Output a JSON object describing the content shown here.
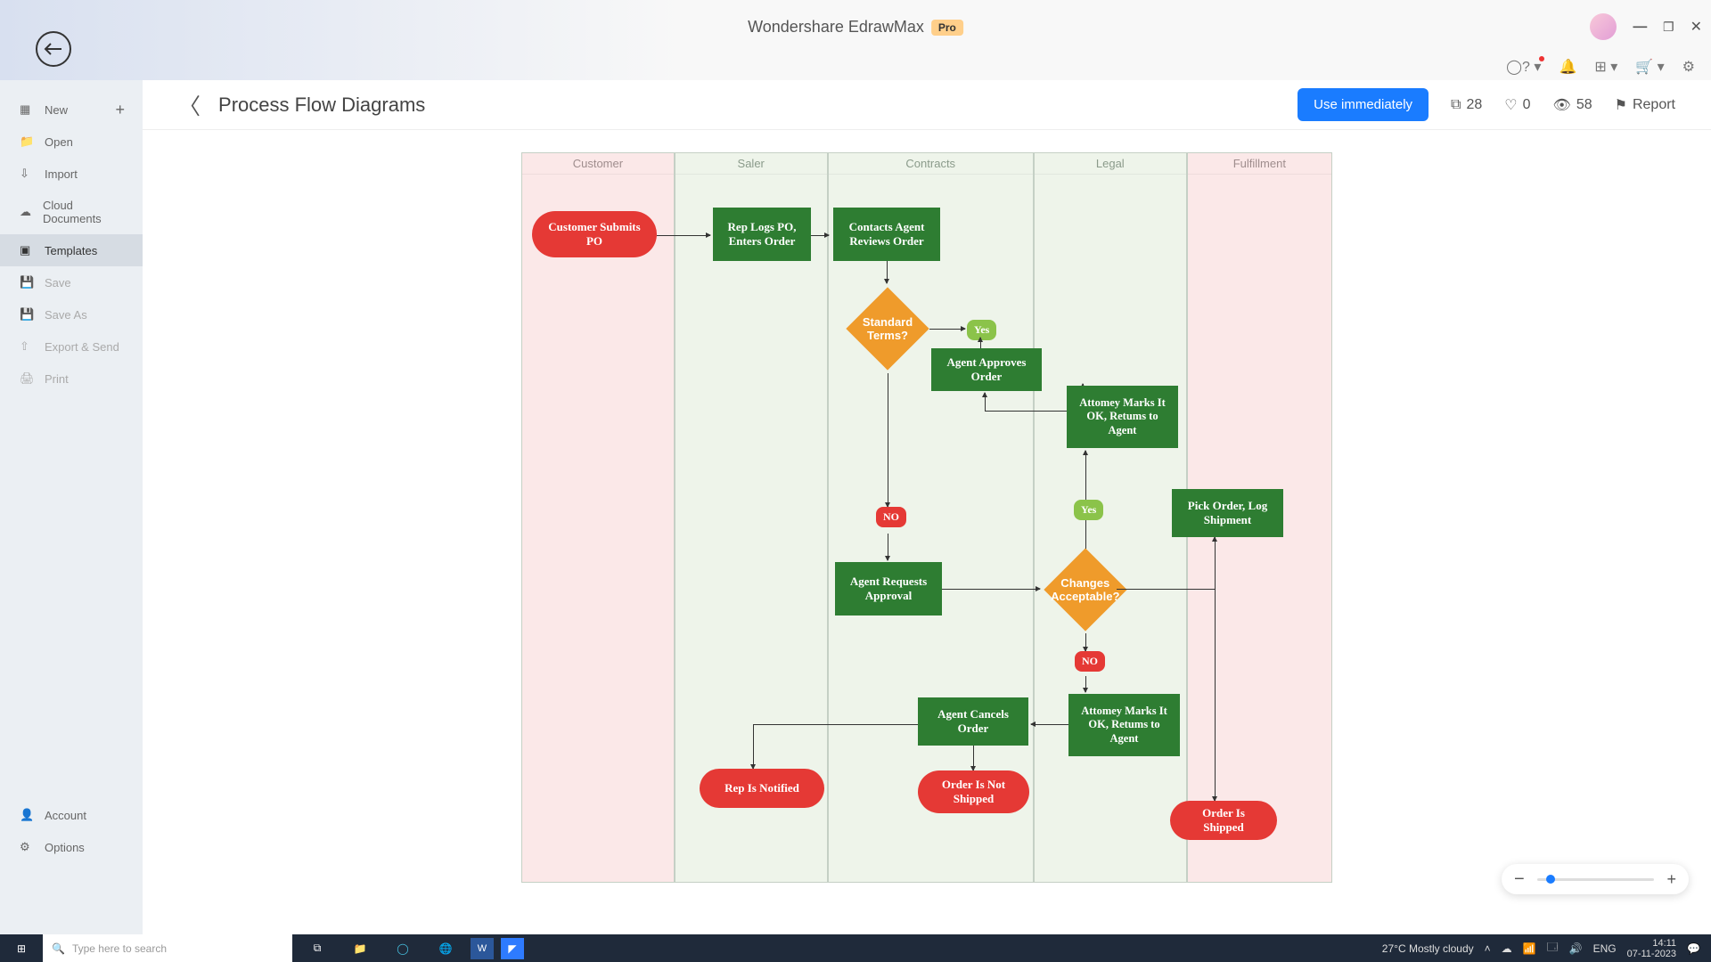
{
  "app": {
    "title": "Wondershare EdrawMax",
    "badge": "Pro"
  },
  "sidebar": {
    "new": "New",
    "open": "Open",
    "import": "Import",
    "cloud": "Cloud Documents",
    "templates": "Templates",
    "save": "Save",
    "saveas": "Save As",
    "export": "Export & Send",
    "print": "Print",
    "account": "Account",
    "options": "Options"
  },
  "header": {
    "title": "Process Flow Diagrams",
    "primary": "Use immediately",
    "copies": "28",
    "likes": "0",
    "views": "58",
    "report": "Report"
  },
  "lanes": {
    "customer": "Customer",
    "saler": "Saler",
    "contracts": "Contracts",
    "legal": "Legal",
    "fulfillment": "Fulfillment"
  },
  "nodes": {
    "submitpo": "Customer Submits PO",
    "replogs": "Rep Logs PO, Enters Order",
    "contactsagent": "Contacts Agent Reviews Order",
    "stdterms": "Standard Terms?",
    "yes1": "Yes",
    "agentapproves": "Agent Approves Order",
    "attorney1": "Attomey Marks It OK, Retums to Agent",
    "yes2": "Yes",
    "no1": "NO",
    "agentrequests": "Agent Requests Approval",
    "pickorder": "Pick Order, Log Shipment",
    "changes": "Changes Acceptable?",
    "no2": "NO",
    "attorney2": "Attomey Marks It OK, Retums to Agent",
    "agentcancels": "Agent Cancels Order",
    "repnotified": "Rep Is Notified",
    "notshipped": "Order Is Not Shipped",
    "shipped": "Order Is Shipped"
  },
  "taskbar": {
    "search_ph": "Type here to search",
    "weather": "27°C  Mostly cloudy",
    "lang": "ENG",
    "time": "14:11",
    "date": "07-11-2023"
  }
}
